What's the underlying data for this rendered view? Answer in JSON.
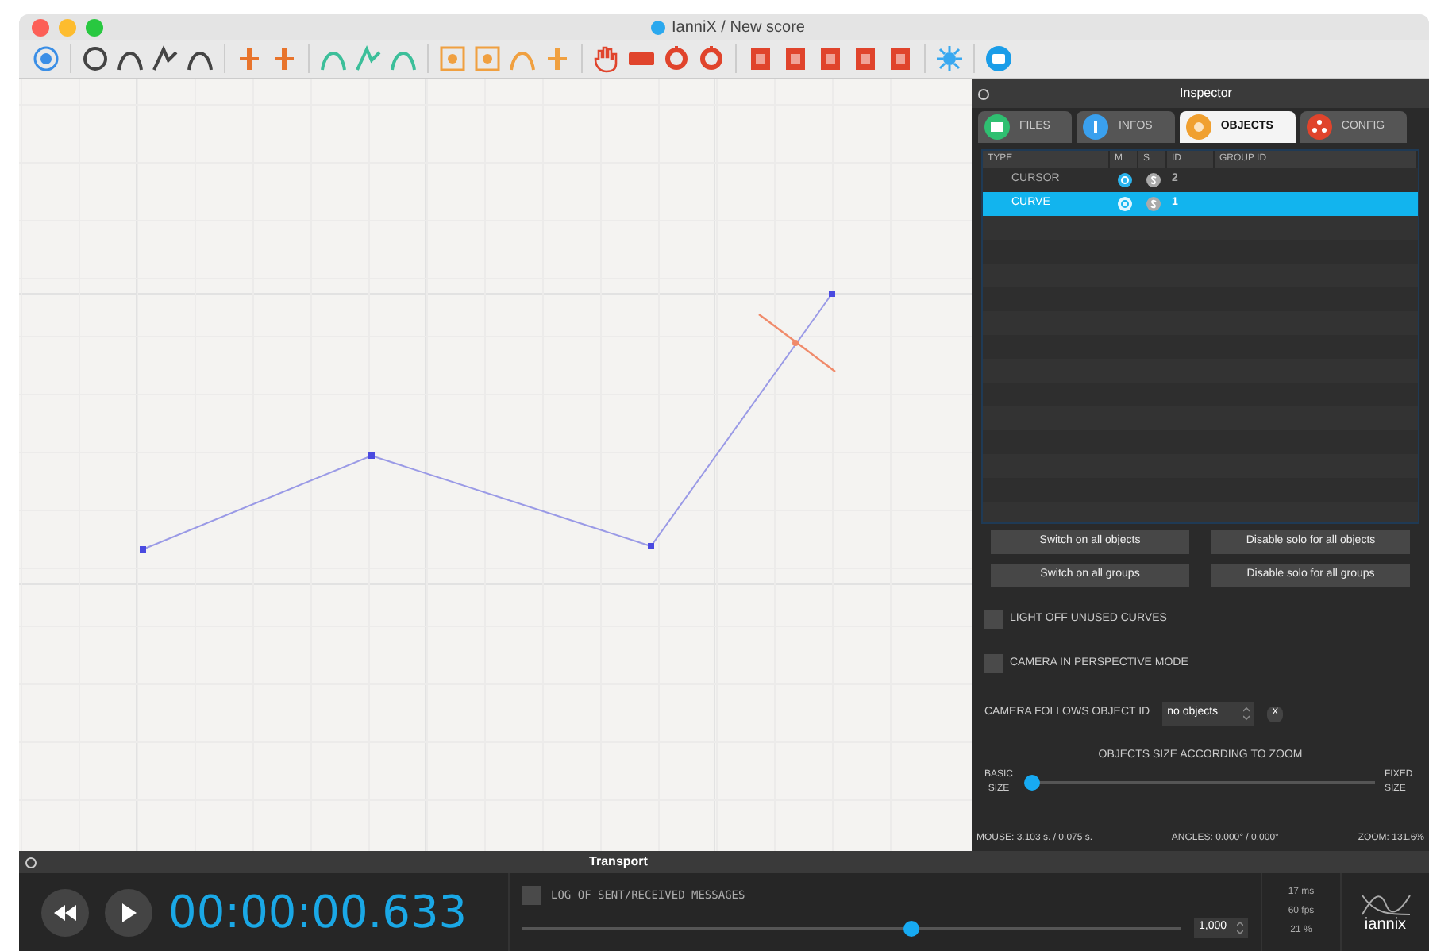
{
  "window": {
    "title": "IanniX / New score"
  },
  "inspector": {
    "title": "Inspector",
    "tabs": [
      {
        "label": "FILES",
        "selected": false,
        "color": "#2fbf71"
      },
      {
        "label": "INFOS",
        "selected": false,
        "color": "#3aa0ee"
      },
      {
        "label": "OBJECTS",
        "selected": true,
        "color": "#f0a030"
      },
      {
        "label": "CONFIG",
        "selected": false,
        "color": "#e0442c"
      }
    ],
    "columns": [
      "TYPE",
      "M",
      "S",
      "ID",
      "GROUP ID"
    ],
    "rows": [
      {
        "type": "CURSOR",
        "id": "2",
        "selected": false
      },
      {
        "type": "CURVE",
        "id": "1",
        "selected": true
      }
    ],
    "buttons": [
      "Switch on all objects",
      "Disable solo for all objects",
      "Switch on all groups",
      "Disable solo for all groups"
    ],
    "options": [
      {
        "label": "LIGHT OFF UNUSED CURVES",
        "checked": false
      },
      {
        "label": "CAMERA IN PERSPECTIVE MODE",
        "checked": false
      }
    ],
    "camera_follows": {
      "label": "CAMERA FOLLOWS OBJECT ID",
      "value": "no objects",
      "clear": "X"
    },
    "size": {
      "title": "OBJECTS SIZE ACCORDING TO ZOOM",
      "min_label": "BASIC SIZE",
      "max_label": "FIXED SIZE",
      "level": 0.02
    },
    "status": [
      "MOUSE: 3.103 s. / 0.075 s.",
      "ANGLES: 0.000° / 0.000°",
      "ZOOM: 131.6%"
    ]
  },
  "transport": {
    "title": "Transport",
    "time": "00:00:00.633",
    "log": {
      "label": "LOG OF SENT/RECEIVED MESSAGES",
      "checked": false
    },
    "speed": {
      "level": 0.59,
      "value": "1,000"
    },
    "stats": [
      "17 ms",
      "60 fps",
      "21 %"
    ],
    "logo": "iannix"
  }
}
